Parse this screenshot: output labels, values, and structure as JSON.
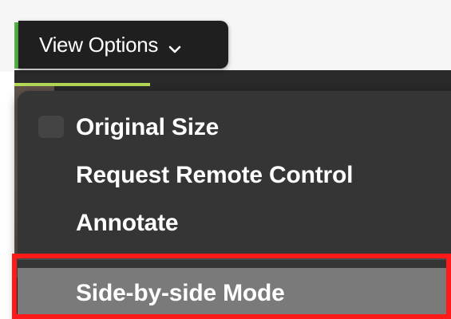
{
  "toolbar": {
    "view_options_label": "View Options",
    "view_options_icon": "chevron-down-icon"
  },
  "menu": {
    "items": [
      {
        "label": "Original Size"
      },
      {
        "label": "Request Remote Control"
      },
      {
        "label": "Annotate"
      },
      {
        "label": "Side-by-side Mode"
      }
    ],
    "highlighted_index": 3
  },
  "colors": {
    "menu_bg": "#353535",
    "button_bg": "#1f1f1f",
    "highlight_bg": "#7a7a7a",
    "annotation_red": "#ff1a1a",
    "accent_green": "#56b947"
  }
}
